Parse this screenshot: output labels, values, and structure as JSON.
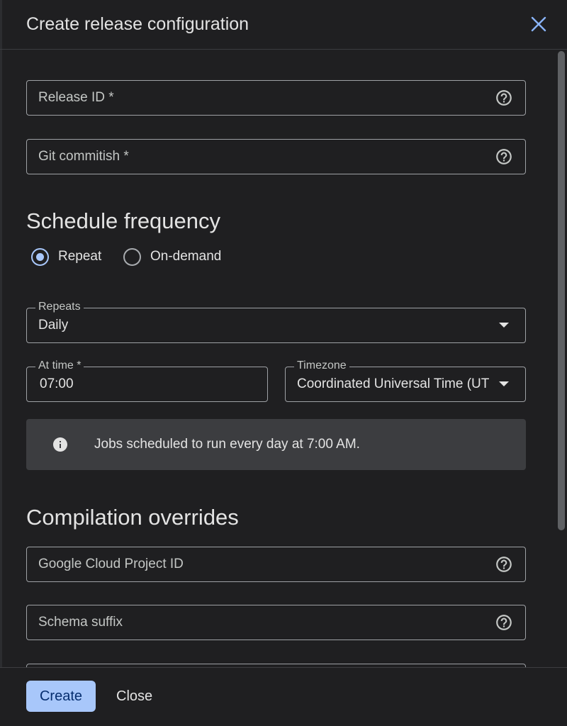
{
  "dialog": {
    "title": "Create release configuration",
    "close_icon": "close-icon"
  },
  "form": {
    "release_id": {
      "label": "Release ID *",
      "help_icon": "help-icon"
    },
    "git_commitish": {
      "label": "Git commitish *",
      "help_icon": "help-icon"
    }
  },
  "schedule": {
    "heading": "Schedule frequency",
    "options": [
      {
        "label": "Repeat",
        "selected": true
      },
      {
        "label": "On-demand",
        "selected": false
      }
    ],
    "repeats": {
      "label": "Repeats",
      "value": "Daily",
      "icon": "dropdown-arrow-icon"
    },
    "at_time": {
      "label": "At time *",
      "value": "07:00"
    },
    "timezone": {
      "label": "Timezone",
      "value": "Coordinated Universal Time (UT",
      "icon": "dropdown-arrow-icon"
    },
    "info": {
      "icon": "info-icon",
      "text": "Jobs scheduled to run every day at 7:00 AM."
    }
  },
  "compilation": {
    "heading": "Compilation overrides",
    "fields": [
      {
        "label": "Google Cloud Project ID",
        "help_icon": "help-icon"
      },
      {
        "label": "Schema suffix",
        "help_icon": "help-icon"
      }
    ]
  },
  "footer": {
    "create_label": "Create",
    "close_label": "Close"
  },
  "colors": {
    "surface": "#1f1f21",
    "outline": "#9ea1a5",
    "accent": "#a8c7fa",
    "on_accent": "#062e6f",
    "close_icon": "#8ab4f8",
    "info_bg": "#3c3d40",
    "text": "#e3e3e3",
    "muted_text": "#c4c7c5",
    "radio_unselected": "#a8abaf",
    "divider": "#3c3d40",
    "scrollbar": "#5f6164"
  }
}
